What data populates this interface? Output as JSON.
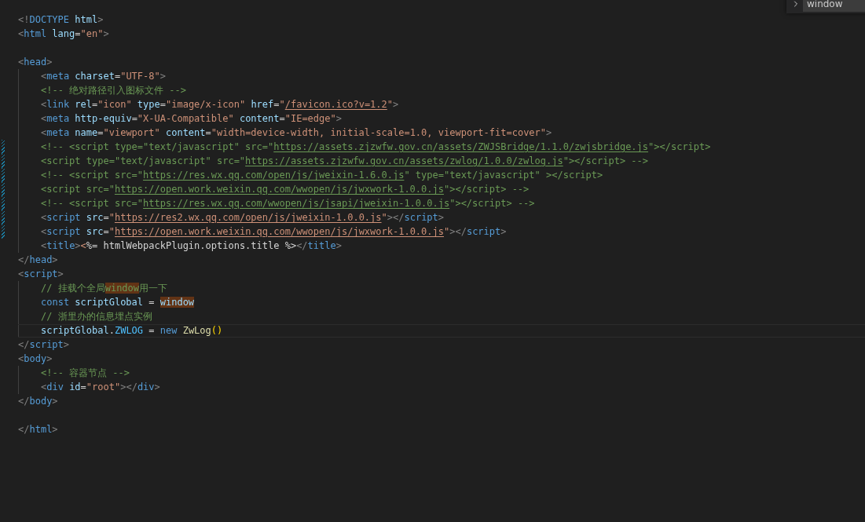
{
  "find_widget": {
    "value": "window"
  },
  "lines": [
    {
      "kind": "code",
      "modified": false,
      "current": false,
      "tokens": [
        {
          "t": "<!",
          "kind": "p"
        },
        {
          "t": "DOCTYPE",
          "kind": "tag"
        },
        {
          "t": " html",
          "kind": "attr"
        },
        {
          "t": ">",
          "kind": "p"
        }
      ]
    },
    {
      "kind": "code",
      "modified": false,
      "current": false,
      "tokens": [
        {
          "t": "<",
          "kind": "p"
        },
        {
          "t": "html",
          "kind": "tag"
        },
        {
          "t": " lang",
          "kind": "attr"
        },
        {
          "t": "=",
          "kind": "op"
        },
        {
          "t": "\"en\"",
          "kind": "str"
        },
        {
          "t": ">",
          "kind": "p"
        }
      ]
    },
    {
      "kind": "blank"
    },
    {
      "kind": "code",
      "modified": false,
      "current": false,
      "tokens": [
        {
          "t": "<",
          "kind": "p"
        },
        {
          "t": "head",
          "kind": "tag"
        },
        {
          "t": ">",
          "kind": "p"
        }
      ],
      "children": [
        {
          "kind": "code",
          "modified": false,
          "current": false,
          "tokens": [
            {
              "t": "<",
              "kind": "p"
            },
            {
              "t": "meta",
              "kind": "tag"
            },
            {
              "t": " charset",
              "kind": "attr"
            },
            {
              "t": "=",
              "kind": "op"
            },
            {
              "t": "\"UTF-8\"",
              "kind": "str"
            },
            {
              "t": ">",
              "kind": "p"
            }
          ]
        },
        {
          "kind": "code",
          "modified": false,
          "current": false,
          "tokens": [
            {
              "t": "<!-- 绝对路径引入图标文件 -->",
              "kind": "cm"
            }
          ]
        },
        {
          "kind": "code",
          "modified": false,
          "current": false,
          "tokens": [
            {
              "t": "<",
              "kind": "p"
            },
            {
              "t": "link",
              "kind": "tag"
            },
            {
              "t": " rel",
              "kind": "attr"
            },
            {
              "t": "=",
              "kind": "op"
            },
            {
              "t": "\"icon\"",
              "kind": "str"
            },
            {
              "t": " type",
              "kind": "attr"
            },
            {
              "t": "=",
              "kind": "op"
            },
            {
              "t": "\"image/x-icon\"",
              "kind": "str"
            },
            {
              "t": " href",
              "kind": "attr"
            },
            {
              "t": "=",
              "kind": "op"
            },
            {
              "t": "\"",
              "kind": "str"
            },
            {
              "t": "/favicon.ico?v=1.2",
              "kind": "url"
            },
            {
              "t": "\"",
              "kind": "str"
            },
            {
              "t": ">",
              "kind": "p"
            }
          ]
        },
        {
          "kind": "code",
          "modified": false,
          "current": false,
          "tokens": [
            {
              "t": "<",
              "kind": "p"
            },
            {
              "t": "meta",
              "kind": "tag"
            },
            {
              "t": " http-equiv",
              "kind": "attr"
            },
            {
              "t": "=",
              "kind": "op"
            },
            {
              "t": "\"X-UA-Compatible\"",
              "kind": "str"
            },
            {
              "t": " content",
              "kind": "attr"
            },
            {
              "t": "=",
              "kind": "op"
            },
            {
              "t": "\"IE=edge\"",
              "kind": "str"
            },
            {
              "t": ">",
              "kind": "p"
            }
          ]
        },
        {
          "kind": "code",
          "modified": false,
          "current": false,
          "tokens": [
            {
              "t": "<",
              "kind": "p"
            },
            {
              "t": "meta",
              "kind": "tag"
            },
            {
              "t": " name",
              "kind": "attr"
            },
            {
              "t": "=",
              "kind": "op"
            },
            {
              "t": "\"viewport\"",
              "kind": "str"
            },
            {
              "t": " content",
              "kind": "attr"
            },
            {
              "t": "=",
              "kind": "op"
            },
            {
              "t": "\"width=device-width, initial-scale=1.0, viewport-fit=cover\"",
              "kind": "str"
            },
            {
              "t": ">",
              "kind": "p"
            }
          ]
        },
        {
          "kind": "code",
          "modified": true,
          "current": false,
          "tokens": [
            {
              "t": "<!-- <script type=\"text/javascript\" src=\"",
              "kind": "cm"
            },
            {
              "t": "https://assets.zjzwfw.gov.cn/assets/ZWJSBridge/1.1.0/zwjsbridge.js",
              "kind": "cmurl"
            },
            {
              "t": "\"></script>",
              "kind": "cm"
            }
          ]
        },
        {
          "kind": "code",
          "modified": true,
          "current": false,
          "tokens": [
            {
              "t": "<script type=\"text/javascript\" src=\"",
              "kind": "cm"
            },
            {
              "t": "https://assets.zjzwfw.gov.cn/assets/zwlog/1.0.0/zwlog.js",
              "kind": "cmurl"
            },
            {
              "t": "\"></script> -->",
              "kind": "cm"
            }
          ]
        },
        {
          "kind": "code",
          "modified": true,
          "current": false,
          "tokens": [
            {
              "t": "<!-- <script src=\"",
              "kind": "cm"
            },
            {
              "t": "https://res.wx.qq.com/open/js/jweixin-1.6.0.js",
              "kind": "cmurl"
            },
            {
              "t": "\" type=\"text/javascript\" ></script>",
              "kind": "cm"
            }
          ]
        },
        {
          "kind": "code",
          "modified": true,
          "current": false,
          "tokens": [
            {
              "t": "<script src=\"",
              "kind": "cm"
            },
            {
              "t": "https://open.work.weixin.qq.com/wwopen/js/jwxwork-1.0.0.js",
              "kind": "cmurl"
            },
            {
              "t": "\"></script> -->",
              "kind": "cm"
            }
          ]
        },
        {
          "kind": "code",
          "modified": true,
          "current": false,
          "tokens": [
            {
              "t": "<!-- <script src=\"",
              "kind": "cm"
            },
            {
              "t": "https://res.wx.qq.com/wwopen/js/jsapi/jweixin-1.0.0.js",
              "kind": "cmurl"
            },
            {
              "t": "\"></script> -->",
              "kind": "cm"
            }
          ]
        },
        {
          "kind": "code",
          "modified": true,
          "current": false,
          "tokens": [
            {
              "t": "<",
              "kind": "p"
            },
            {
              "t": "script",
              "kind": "tag"
            },
            {
              "t": " src",
              "kind": "attr"
            },
            {
              "t": "=",
              "kind": "op"
            },
            {
              "t": "\"",
              "kind": "str"
            },
            {
              "t": "https://res2.wx.qq.com/open/js/jweixin-1.0.0.js",
              "kind": "url"
            },
            {
              "t": "\"",
              "kind": "str"
            },
            {
              "t": "></",
              "kind": "p"
            },
            {
              "t": "script",
              "kind": "tag"
            },
            {
              "t": ">",
              "kind": "p"
            }
          ]
        },
        {
          "kind": "code",
          "modified": true,
          "current": false,
          "tokens": [
            {
              "t": "<",
              "kind": "p"
            },
            {
              "t": "script",
              "kind": "tag"
            },
            {
              "t": " src",
              "kind": "attr"
            },
            {
              "t": "=",
              "kind": "op"
            },
            {
              "t": "\"",
              "kind": "str"
            },
            {
              "t": "https://open.work.weixin.qq.com/wwopen/js/jwxwork-1.0.0.js",
              "kind": "url"
            },
            {
              "t": "\"",
              "kind": "str"
            },
            {
              "t": "></",
              "kind": "p"
            },
            {
              "t": "script",
              "kind": "tag"
            },
            {
              "t": ">",
              "kind": "p"
            }
          ]
        },
        {
          "kind": "code",
          "modified": false,
          "current": false,
          "tokens": [
            {
              "t": "<",
              "kind": "p"
            },
            {
              "t": "title",
              "kind": "tag"
            },
            {
              "t": ">",
              "kind": "p"
            },
            {
              "t": "<",
              "kind": "str"
            },
            {
              "t": "%= htmlWebpackPlugin.options.title %>",
              "kind": "text"
            },
            {
              "t": "</",
              "kind": "p"
            },
            {
              "t": "title",
              "kind": "tag"
            },
            {
              "t": ">",
              "kind": "p"
            }
          ]
        }
      ]
    },
    {
      "kind": "code",
      "modified": false,
      "current": false,
      "tokens": [
        {
          "t": "</",
          "kind": "p"
        },
        {
          "t": "head",
          "kind": "tag"
        },
        {
          "t": ">",
          "kind": "p"
        }
      ]
    },
    {
      "kind": "code",
      "modified": false,
      "current": false,
      "tokens": [
        {
          "t": "<",
          "kind": "p"
        },
        {
          "t": "script",
          "kind": "tag"
        },
        {
          "t": ">",
          "kind": "p"
        }
      ],
      "children": [
        {
          "kind": "code",
          "modified": false,
          "current": false,
          "tokens": [
            {
              "t": "// 挂载个全局",
              "kind": "cm"
            },
            {
              "t": "window",
              "kind": "cm",
              "match": true
            },
            {
              "t": "用一下",
              "kind": "cm"
            }
          ]
        },
        {
          "kind": "code",
          "modified": false,
          "current": false,
          "tokens": [
            {
              "t": "const",
              "kind": "kw"
            },
            {
              "t": " scriptGlobal",
              "kind": "var"
            },
            {
              "t": " = ",
              "kind": "op"
            },
            {
              "t": "window",
              "kind": "var",
              "match": true
            }
          ]
        },
        {
          "kind": "code",
          "modified": false,
          "current": false,
          "tokens": [
            {
              "t": "// 浙里办的信息埋点实例",
              "kind": "cm"
            }
          ]
        },
        {
          "kind": "code",
          "modified": false,
          "current": true,
          "tokens": [
            {
              "t": "scriptGlobal",
              "kind": "var"
            },
            {
              "t": ".",
              "kind": "op"
            },
            {
              "t": "ZWLOG",
              "kind": "const"
            },
            {
              "t": " = ",
              "kind": "op"
            },
            {
              "t": "new",
              "kind": "kw"
            },
            {
              "t": " ZwLog",
              "kind": "fn"
            },
            {
              "t": "()",
              "kind": "br"
            }
          ]
        }
      ]
    },
    {
      "kind": "code",
      "modified": false,
      "current": false,
      "tokens": [
        {
          "t": "</",
          "kind": "p"
        },
        {
          "t": "script",
          "kind": "tag"
        },
        {
          "t": ">",
          "kind": "p"
        }
      ]
    },
    {
      "kind": "code",
      "modified": false,
      "current": false,
      "tokens": [
        {
          "t": "<",
          "kind": "p"
        },
        {
          "t": "body",
          "kind": "tag"
        },
        {
          "t": ">",
          "kind": "p"
        }
      ],
      "children": [
        {
          "kind": "code",
          "modified": false,
          "current": false,
          "tokens": [
            {
              "t": "<!-- 容器节点 -->",
              "kind": "cm"
            }
          ]
        },
        {
          "kind": "code",
          "modified": false,
          "current": false,
          "tokens": [
            {
              "t": "<",
              "kind": "p"
            },
            {
              "t": "div",
              "kind": "tag"
            },
            {
              "t": " id",
              "kind": "attr"
            },
            {
              "t": "=",
              "kind": "op"
            },
            {
              "t": "\"root\"",
              "kind": "str"
            },
            {
              "t": "></",
              "kind": "p"
            },
            {
              "t": "div",
              "kind": "tag"
            },
            {
              "t": ">",
              "kind": "p"
            }
          ]
        }
      ]
    },
    {
      "kind": "code",
      "modified": false,
      "current": false,
      "tokens": [
        {
          "t": "</",
          "kind": "p"
        },
        {
          "t": "body",
          "kind": "tag"
        },
        {
          "t": ">",
          "kind": "p"
        }
      ]
    },
    {
      "kind": "blank"
    },
    {
      "kind": "code",
      "modified": false,
      "current": false,
      "tokens": [
        {
          "t": "</",
          "kind": "p"
        },
        {
          "t": "html",
          "kind": "tag"
        },
        {
          "t": ">",
          "kind": "p"
        }
      ]
    }
  ]
}
